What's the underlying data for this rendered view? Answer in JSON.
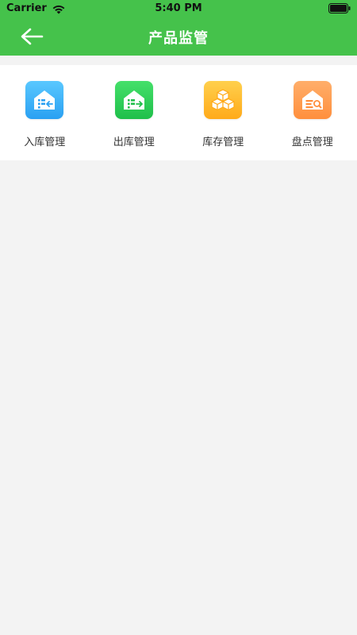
{
  "status_bar": {
    "carrier": "Carrier",
    "time": "5:40 PM"
  },
  "nav": {
    "title": "产品监管",
    "back_icon": "arrow-left-icon"
  },
  "menu": {
    "items": [
      {
        "label": "入库管理",
        "icon": "warehouse-in-icon",
        "color": "#2aa0f2"
      },
      {
        "label": "出库管理",
        "icon": "warehouse-out-icon",
        "color": "#1fbf4a"
      },
      {
        "label": "库存管理",
        "icon": "inventory-boxes-icon",
        "color": "#ffaa1a"
      },
      {
        "label": "盘点管理",
        "icon": "stocktake-search-icon",
        "color": "#ff8f3d"
      }
    ]
  },
  "colors": {
    "header": "#45c24b",
    "background": "#f3f3f3",
    "panel": "#ffffff"
  }
}
